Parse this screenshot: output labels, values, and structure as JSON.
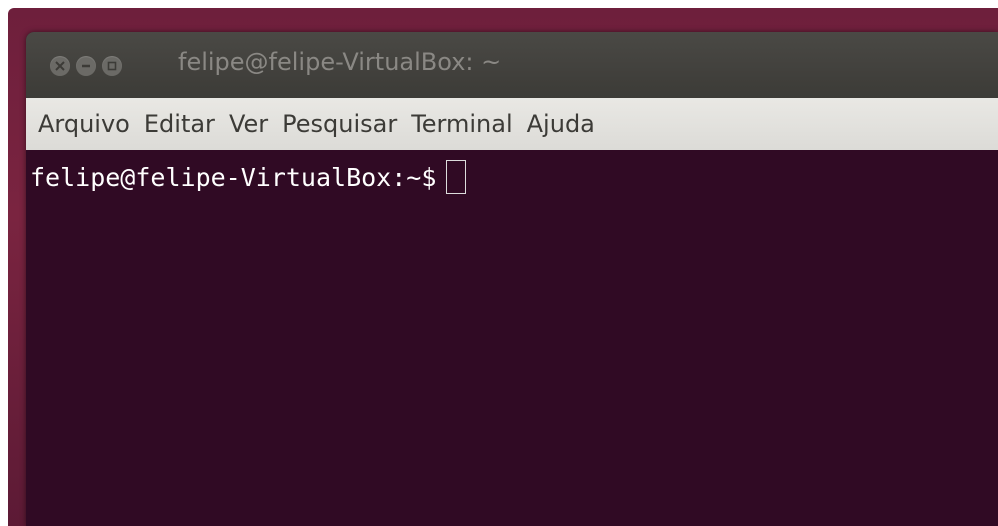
{
  "window": {
    "title": "felipe@felipe-VirtualBox: ~",
    "controls": {
      "close_icon": "close-icon",
      "minimize_icon": "minimize-icon",
      "maximize_icon": "maximize-icon"
    }
  },
  "menu": {
    "items": [
      "Arquivo",
      "Editar",
      "Ver",
      "Pesquisar",
      "Terminal",
      "Ajuda"
    ]
  },
  "terminal": {
    "prompt": "felipe@felipe-VirtualBox:~$",
    "input": ""
  },
  "colors": {
    "terminal_bg": "#300a24",
    "titlebar_bg": "#3c3b37",
    "menubar_bg": "#dfdbd2",
    "prompt_text": "#ffffff"
  }
}
